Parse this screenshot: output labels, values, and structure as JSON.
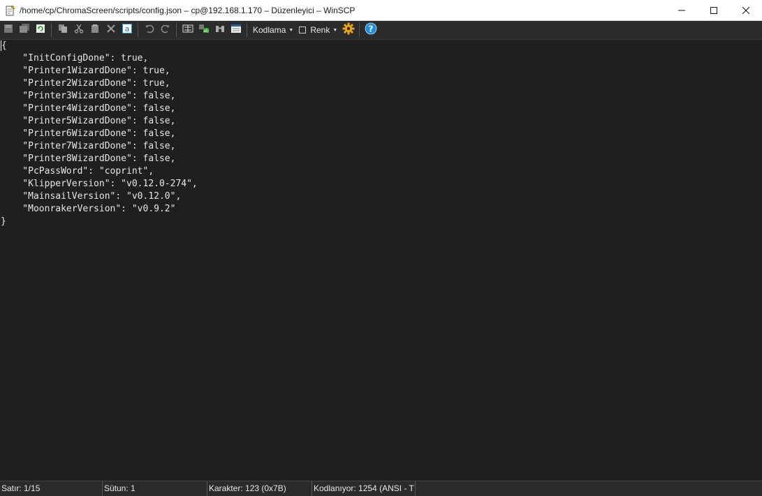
{
  "window": {
    "title": "/home/cp/ChromaScreen/scripts/config.json – cp@192.168.1.170 – Düzenleyici – WinSCP",
    "minimize_glyph": "—",
    "maximize_glyph": "☐",
    "close_glyph": "✕"
  },
  "toolbar": {
    "encoding_label": "Kodlama",
    "color_label": "Renk"
  },
  "editor": {
    "lines": [
      "{",
      "    \"InitConfigDone\": true,",
      "    \"Printer1WizardDone\": true,",
      "    \"Printer2WizardDone\": true,",
      "    \"Printer3WizardDone\": false,",
      "    \"Printer4WizardDone\": false,",
      "    \"Printer5WizardDone\": false,",
      "    \"Printer6WizardDone\": false,",
      "    \"Printer7WizardDone\": false,",
      "    \"Printer8WizardDone\": false,",
      "    \"PcPassWord\": \"coprint\",",
      "    \"KlipperVersion\": \"v0.12.0-274\",",
      "    \"MainsailVersion\": \"v0.12.0\",",
      "    \"MoonrakerVersion\": \"v0.9.2\"",
      "}"
    ]
  },
  "status": {
    "line": "Satır: 1/15",
    "column": "Sütun: 1",
    "character": "Karakter: 123 (0x7B)",
    "encoding": "Kodlanıyor: 1254  (ANSI - T"
  },
  "colors": {
    "background": "#1f1f1f",
    "toolbar": "#2b2b2b",
    "text": "#e6e6e6",
    "help_blue": "#1e90d8",
    "settings_orange": "#e9a21a"
  }
}
